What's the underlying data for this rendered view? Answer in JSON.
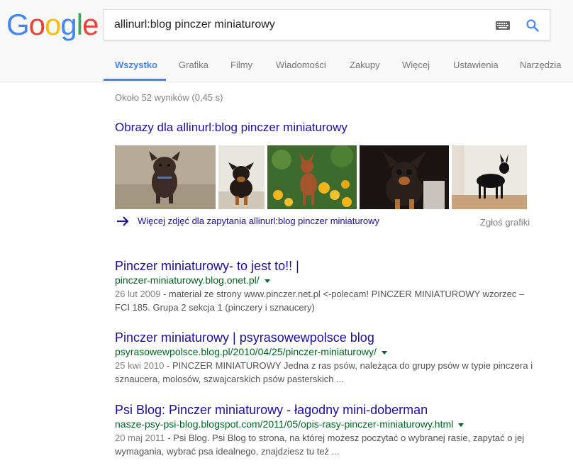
{
  "logo": [
    "G",
    "o",
    "o",
    "g",
    "l",
    "e"
  ],
  "search": {
    "query": "allinurl:blog pinczer miniaturowy"
  },
  "tabs": [
    {
      "label": "Wszystko",
      "active": true
    },
    {
      "label": "Grafika"
    },
    {
      "label": "Filmy"
    },
    {
      "label": "Wiadomości"
    },
    {
      "label": "Zakupy"
    },
    {
      "label": "Więcej"
    },
    {
      "label": "Ustawienia"
    },
    {
      "label": "Narzędzia"
    }
  ],
  "stats": "Około 52 wyników (0,45 s)",
  "images": {
    "title": "Obrazy dla allinurl:blog pinczer miniaturowy",
    "more_link": "Więcej zdjęć dla zapytania allinurl:blog pinczer miniaturowy",
    "report": "Zgłoś grafiki"
  },
  "results": [
    {
      "title": "Pinczer miniaturowy- to jest to!! |",
      "url": "pinczer-miniaturowy.blog.onet.pl/",
      "date": "26 lut 2009",
      "snippet": " - materiał ze strony www.pinczer.net.pl <-polecam! PINCZER MINIATUROWY wzorzec – FCI 185. Grupa 2 sekcja 1 (pinczery i sznaucery)"
    },
    {
      "title": "Pinczer miniaturowy | psyrasowewpolsce blog",
      "url": "psyrasowewpolsce.blog.pl/2010/04/25/pinczer-miniaturowy/",
      "date": "25 kwi 2010",
      "snippet": " - PINCZER MINIATUROWY Jedna z ras psów, należąca do grupy psów w typie pinczera i sznaucera, molosów, szwajcarskich psów pasterskich ..."
    },
    {
      "title": "Psi Blog: Pinczer miniaturowy - łagodny mini-doberman",
      "url": "nasze-psy-psi-blog.blogspot.com/2011/05/opis-rasy-pinczer-miniaturowy.html",
      "date": "20 maj 2011",
      "snippet": " - Psi Blog. Psi Blog to strona, na której możesz poczytać o wybranej rasie, zapytać o jej wymagania, wybrać psa idealnego, znajdziesz tu też ..."
    }
  ],
  "colors": {
    "link": "#1a0dab",
    "url": "#006621",
    "accent": "#4285f4"
  }
}
